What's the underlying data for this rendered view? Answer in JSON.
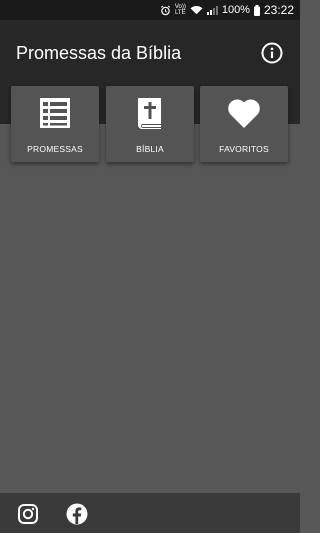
{
  "status_bar": {
    "volte": "Vo))\nLTE",
    "battery": "100%",
    "time": "23:22"
  },
  "header": {
    "title": "Promessas da Bíblia",
    "info_icon": "info-icon"
  },
  "tiles": [
    {
      "label": "PROMESSAS",
      "icon": "list-icon"
    },
    {
      "label": "BÍBLIA",
      "icon": "bible-icon"
    },
    {
      "label": "FAVORITOS",
      "icon": "heart-icon"
    }
  ],
  "bottom_bar": {
    "icons": [
      "instagram-icon",
      "facebook-icon"
    ]
  },
  "colors": {
    "header": "#272727",
    "body": "#575757",
    "tile": "#545454",
    "bottom_bar": "#3a3a3a"
  }
}
